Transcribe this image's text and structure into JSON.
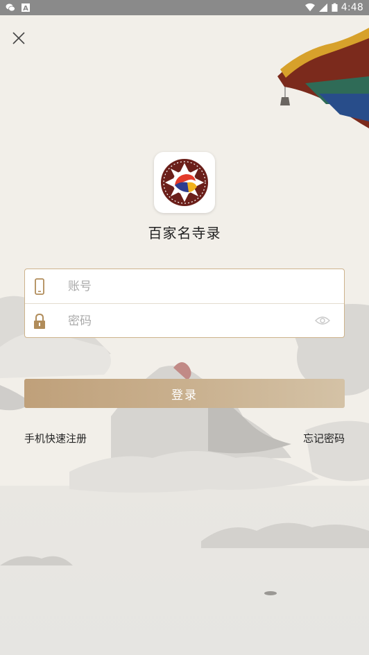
{
  "status_bar": {
    "time": "4:48",
    "left_icons": [
      "wechat-icon",
      "a-app-icon"
    ],
    "right_icons": [
      "wifi-icon",
      "signal-icon",
      "battery-icon"
    ]
  },
  "app": {
    "name": "百家名寺录",
    "logo_icon": "temple-lotus-logo"
  },
  "form": {
    "account_placeholder": "账号",
    "password_placeholder": "密码",
    "login_label": "登录"
  },
  "links": {
    "register": "手机快速注册",
    "forgot": "忘记密码"
  },
  "colors": {
    "accent": "#c4a884",
    "border": "#cdb28b",
    "background": "#f1eee8"
  }
}
